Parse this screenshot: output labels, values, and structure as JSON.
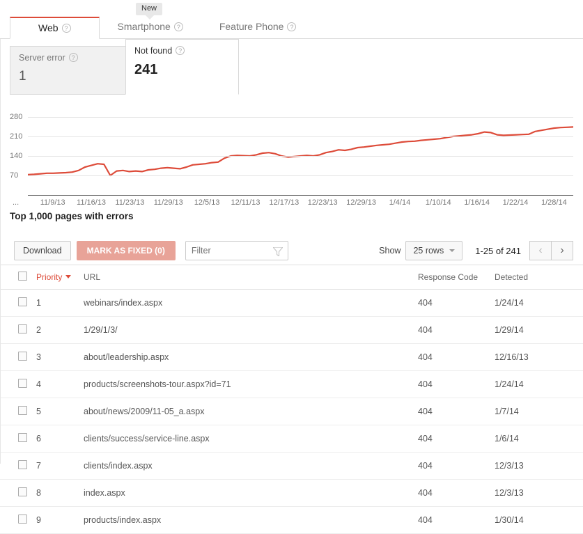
{
  "badge": {
    "label": "New"
  },
  "tabs": [
    {
      "label": "Web",
      "help": "?",
      "active": true
    },
    {
      "label": "Smartphone",
      "help": "?",
      "active": false
    },
    {
      "label": "Feature Phone",
      "help": "?",
      "active": false
    }
  ],
  "cards": [
    {
      "label": "Server error",
      "help": "?",
      "value": "1",
      "selected": false
    },
    {
      "label": "Not found",
      "help": "?",
      "value": "241",
      "selected": true
    }
  ],
  "chart_data": {
    "type": "line",
    "title": "",
    "xlabel": "",
    "ylabel": "",
    "ylim": [
      0,
      315
    ],
    "yticks": [
      70,
      140,
      210,
      280
    ],
    "grid": true,
    "legend": "none",
    "line_color": "#dd4b39",
    "xtick_labels": [
      "...",
      "11/9/13",
      "11/16/13",
      "11/23/13",
      "11/29/13",
      "12/5/13",
      "12/11/13",
      "12/17/13",
      "12/23/13",
      "12/29/13",
      "1/4/14",
      "1/10/14",
      "1/16/14",
      "1/22/14",
      "1/28/14"
    ],
    "x": [
      "11/6/13",
      "11/7/13",
      "11/8/13",
      "11/9/13",
      "11/10/13",
      "11/11/13",
      "11/12/13",
      "11/13/13",
      "11/14/13",
      "11/15/13",
      "11/16/13",
      "11/17/13",
      "11/18/13",
      "11/19/13",
      "11/20/13",
      "11/21/13",
      "11/22/13",
      "11/23/13",
      "11/24/13",
      "11/25/13",
      "11/26/13",
      "11/27/13",
      "11/28/13",
      "11/29/13",
      "11/30/13",
      "12/1/13",
      "12/2/13",
      "12/3/13",
      "12/4/13",
      "12/5/13",
      "12/6/13",
      "12/7/13",
      "12/8/13",
      "12/9/13",
      "12/10/13",
      "12/11/13",
      "12/12/13",
      "12/13/13",
      "12/14/13",
      "12/15/13",
      "12/16/13",
      "12/17/13",
      "12/18/13",
      "12/19/13",
      "12/20/13",
      "12/21/13",
      "12/22/13",
      "12/23/13",
      "12/24/13",
      "12/25/13",
      "12/26/13",
      "12/27/13",
      "12/28/13",
      "12/29/13",
      "12/30/13",
      "12/31/13",
      "1/1/14",
      "1/2/14",
      "1/3/14",
      "1/4/14",
      "1/5/14",
      "1/6/14",
      "1/7/14",
      "1/8/14",
      "1/9/14",
      "1/10/14",
      "1/11/14",
      "1/12/14",
      "1/13/14",
      "1/14/14",
      "1/15/14",
      "1/16/14",
      "1/17/14",
      "1/18/14",
      "1/19/14",
      "1/20/14",
      "1/21/14",
      "1/22/14",
      "1/23/14",
      "1/24/14",
      "1/25/14",
      "1/26/14",
      "1/27/14",
      "1/28/14",
      "1/29/14",
      "1/30/14"
    ],
    "values": [
      73,
      74,
      76,
      78,
      78,
      79,
      80,
      82,
      88,
      100,
      106,
      112,
      110,
      70,
      86,
      88,
      84,
      86,
      84,
      90,
      92,
      96,
      98,
      96,
      94,
      100,
      108,
      110,
      112,
      116,
      118,
      132,
      140,
      142,
      141,
      140,
      144,
      150,
      152,
      148,
      140,
      136,
      138,
      140,
      142,
      140,
      144,
      152,
      156,
      162,
      160,
      164,
      170,
      172,
      175,
      178,
      180,
      182,
      186,
      190,
      192,
      193,
      196,
      198,
      200,
      202,
      206,
      210,
      212,
      214,
      216,
      220,
      226,
      224,
      216,
      214,
      215,
      216,
      217,
      218,
      228,
      232,
      236,
      240,
      242,
      243,
      244
    ]
  },
  "section": {
    "title": "Top 1,000 pages with errors"
  },
  "toolbar": {
    "download_label": "Download",
    "mark_fixed_label": "MARK AS FIXED (0)",
    "filter_placeholder": "Filter",
    "filter_value": "",
    "show_label": "Show",
    "rows_value": "25 rows",
    "pager_count": "1-25 of 241",
    "prev_glyph": "‹",
    "next_glyph": "›"
  },
  "table": {
    "columns": [
      "Priority",
      "URL",
      "Response Code",
      "Detected"
    ],
    "rows": [
      {
        "priority": "1",
        "url": "webinars/index.aspx",
        "code": "404",
        "detected": "1/24/14"
      },
      {
        "priority": "2",
        "url": "1/29/1/3/",
        "code": "404",
        "detected": "1/29/14"
      },
      {
        "priority": "3",
        "url": "about/leadership.aspx",
        "code": "404",
        "detected": "12/16/13"
      },
      {
        "priority": "4",
        "url": "products/screenshots-tour.aspx?id=71",
        "code": "404",
        "detected": "1/24/14"
      },
      {
        "priority": "5",
        "url": "about/news/2009/11-05_a.aspx",
        "code": "404",
        "detected": "1/7/14"
      },
      {
        "priority": "6",
        "url": "clients/success/service-line.aspx",
        "code": "404",
        "detected": "1/6/14"
      },
      {
        "priority": "7",
        "url": "clients/index.aspx",
        "code": "404",
        "detected": "12/3/13"
      },
      {
        "priority": "8",
        "url": "index.aspx",
        "code": "404",
        "detected": "12/3/13"
      },
      {
        "priority": "9",
        "url": "products/index.aspx",
        "code": "404",
        "detected": "1/30/14"
      }
    ]
  }
}
